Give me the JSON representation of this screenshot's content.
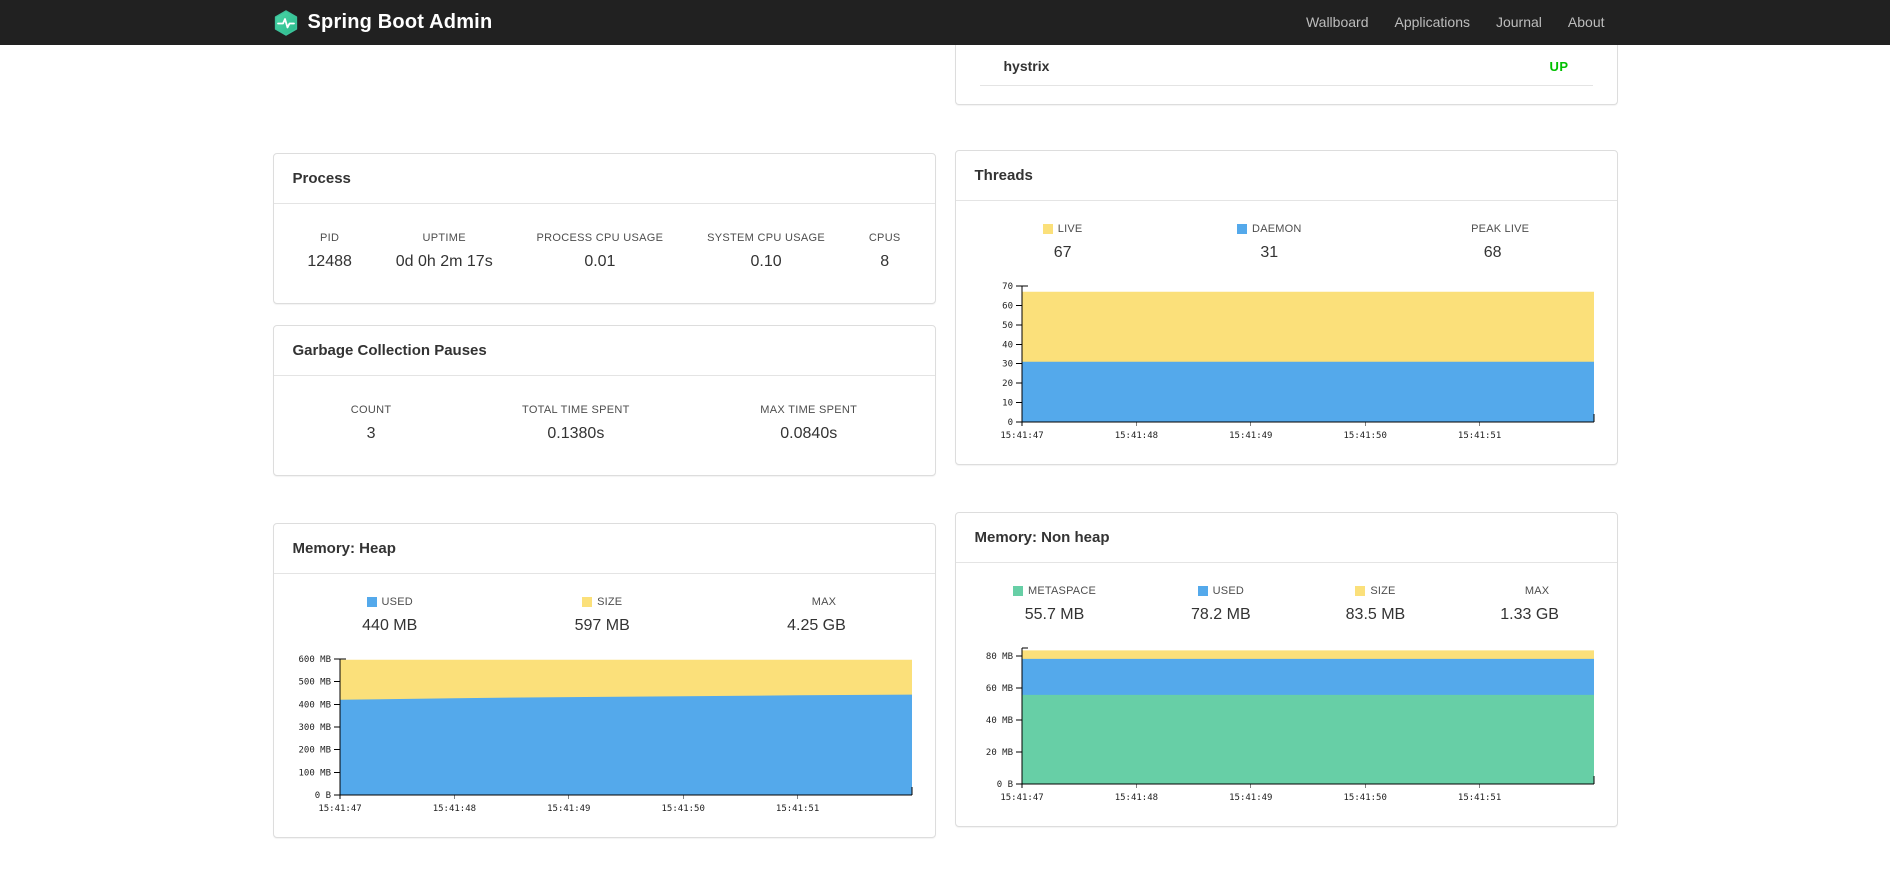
{
  "navbar": {
    "brand": "Spring Boot Admin",
    "items": [
      {
        "label": "Wallboard"
      },
      {
        "label": "Applications"
      },
      {
        "label": "Journal"
      },
      {
        "label": "About"
      }
    ]
  },
  "application_status": {
    "name": "hystrix",
    "status": "UP",
    "status_color": "#00c000"
  },
  "colors": {
    "yellow": "#fbe07a",
    "blue": "#54a9eb",
    "green": "#67cfa6",
    "navbar": "#212121",
    "brand_logo": "#3cc39b"
  },
  "panels": {
    "process": {
      "title": "Process",
      "metrics": [
        {
          "label": "PID",
          "value": "12488"
        },
        {
          "label": "UPTIME",
          "value": "0d 0h 2m 17s"
        },
        {
          "label": "PROCESS CPU USAGE",
          "value": "0.01"
        },
        {
          "label": "SYSTEM CPU USAGE",
          "value": "0.10"
        },
        {
          "label": "CPUS",
          "value": "8"
        }
      ]
    },
    "gc": {
      "title": "Garbage Collection Pauses",
      "metrics": [
        {
          "label": "COUNT",
          "value": "3"
        },
        {
          "label": "TOTAL TIME SPENT",
          "value": "0.1380s"
        },
        {
          "label": "MAX TIME SPENT",
          "value": "0.0840s"
        }
      ]
    },
    "threads": {
      "title": "Threads",
      "legend": [
        {
          "label": "LIVE",
          "value": "67",
          "color": "#fbe07a"
        },
        {
          "label": "DAEMON",
          "value": "31",
          "color": "#54a9eb"
        },
        {
          "label": "PEAK LIVE",
          "value": "68",
          "color": ""
        }
      ]
    },
    "memory_heap": {
      "title": "Memory: Heap",
      "legend": [
        {
          "label": "USED",
          "value": "440 MB",
          "color": "#54a9eb"
        },
        {
          "label": "SIZE",
          "value": "597 MB",
          "color": "#fbe07a"
        },
        {
          "label": "MAX",
          "value": "4.25 GB",
          "color": ""
        }
      ]
    },
    "memory_nonheap": {
      "title": "Memory: Non heap",
      "legend": [
        {
          "label": "METASPACE",
          "value": "55.7 MB",
          "color": "#67cfa6"
        },
        {
          "label": "USED",
          "value": "78.2 MB",
          "color": "#54a9eb"
        },
        {
          "label": "SIZE",
          "value": "83.5 MB",
          "color": "#fbe07a"
        },
        {
          "label": "MAX",
          "value": "1.33 GB",
          "color": ""
        }
      ]
    }
  },
  "chart_data": [
    {
      "id": "threads",
      "type": "area",
      "title": "Threads",
      "x_labels": [
        "15:41:47",
        "15:41:48",
        "15:41:49",
        "15:41:50",
        "15:41:51"
      ],
      "ylim": [
        0,
        70
      ],
      "yticks": [
        0,
        10,
        20,
        30,
        40,
        50,
        60,
        70
      ],
      "ytick_labels": [
        "0",
        "10",
        "20",
        "30",
        "40",
        "50",
        "60",
        "70"
      ],
      "legend_position": "top",
      "series": [
        {
          "name": "LIVE",
          "color": "#fbe07a",
          "values": [
            67,
            67,
            67,
            67,
            67,
            67
          ]
        },
        {
          "name": "DAEMON",
          "color": "#54a9eb",
          "values": [
            31,
            31,
            31,
            31,
            31,
            31
          ]
        }
      ]
    },
    {
      "id": "memory-heap",
      "type": "area",
      "title": "Memory: Heap",
      "x_labels": [
        "15:41:47",
        "15:41:48",
        "15:41:49",
        "15:41:50",
        "15:41:51"
      ],
      "ylim": [
        0,
        600
      ],
      "yticks": [
        0,
        100,
        200,
        300,
        400,
        500,
        600
      ],
      "ytick_labels": [
        "0 B",
        "100 MB",
        "200 MB",
        "300 MB",
        "400 MB",
        "500 MB",
        "600 MB"
      ],
      "unit": "MB",
      "legend_position": "top",
      "series": [
        {
          "name": "SIZE",
          "color": "#fbe07a",
          "values": [
            597,
            597,
            597,
            597,
            597,
            597
          ]
        },
        {
          "name": "USED",
          "color": "#54a9eb",
          "values": [
            420,
            427,
            432,
            436,
            440,
            443
          ]
        }
      ]
    },
    {
      "id": "memory-nonheap",
      "type": "area",
      "title": "Memory: Non heap",
      "x_labels": [
        "15:41:47",
        "15:41:48",
        "15:41:49",
        "15:41:50",
        "15:41:51"
      ],
      "ylim": [
        0,
        85
      ],
      "yticks": [
        0,
        20,
        40,
        60,
        80
      ],
      "ytick_labels": [
        "0 B",
        "20 MB",
        "40 MB",
        "60 MB",
        "80 MB"
      ],
      "unit": "MB",
      "legend_position": "top",
      "series": [
        {
          "name": "SIZE",
          "color": "#fbe07a",
          "values": [
            83.5,
            83.5,
            83.5,
            83.5,
            83.5,
            83.5
          ]
        },
        {
          "name": "USED",
          "color": "#54a9eb",
          "values": [
            78.2,
            78.2,
            78.2,
            78.2,
            78.2,
            78.2
          ]
        },
        {
          "name": "METASPACE",
          "color": "#67cfa6",
          "values": [
            55.7,
            55.7,
            55.7,
            55.7,
            55.7,
            55.7
          ]
        }
      ]
    }
  ]
}
